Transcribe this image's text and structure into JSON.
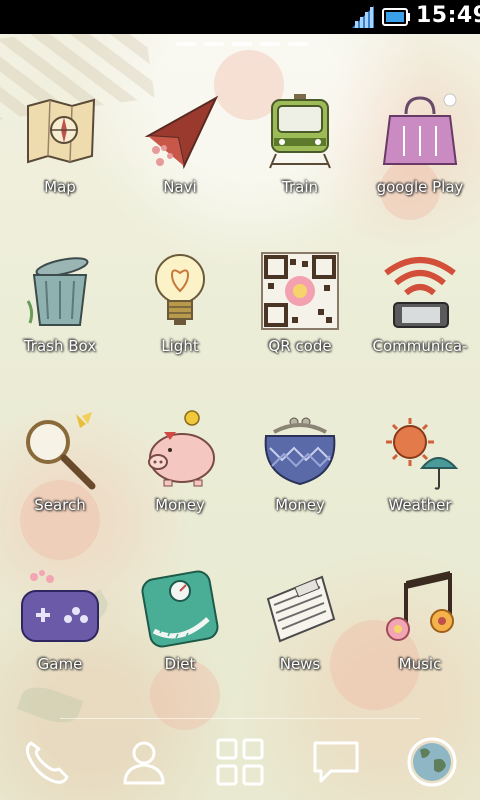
{
  "status_bar": {
    "time": "15:49",
    "signal_icon": "signal-icon",
    "battery_icon": "battery-icon"
  },
  "home": {
    "page_count": 5,
    "active_page": 3,
    "apps": [
      {
        "label": "Map",
        "icon": "map-icon"
      },
      {
        "label": "Navi",
        "icon": "navi-arrow-icon"
      },
      {
        "label": "Train",
        "icon": "train-icon"
      },
      {
        "label": "google Play",
        "icon": "shopping-bag-icon"
      },
      {
        "label": "Trash Box",
        "icon": "trash-can-icon"
      },
      {
        "label": "Light",
        "icon": "light-bulb-icon"
      },
      {
        "label": "QR code",
        "icon": "qr-code-icon"
      },
      {
        "label": "Communica-",
        "icon": "wifi-icon"
      },
      {
        "label": "Search",
        "icon": "magnifier-icon"
      },
      {
        "label": "Money",
        "icon": "piggy-bank-icon"
      },
      {
        "label": "Money",
        "icon": "purse-icon"
      },
      {
        "label": "Weather",
        "icon": "sun-umbrella-icon"
      },
      {
        "label": "Game",
        "icon": "game-console-icon"
      },
      {
        "label": "Diet",
        "icon": "scale-icon"
      },
      {
        "label": "News",
        "icon": "newspaper-icon"
      },
      {
        "label": "Music",
        "icon": "music-note-icon"
      }
    ]
  },
  "dock": {
    "items": [
      {
        "name": "phone",
        "icon": "phone-icon"
      },
      {
        "name": "contacts",
        "icon": "contacts-icon"
      },
      {
        "name": "apps",
        "icon": "app-drawer-icon"
      },
      {
        "name": "messaging",
        "icon": "message-icon"
      },
      {
        "name": "browser",
        "icon": "globe-icon"
      }
    ]
  },
  "colors": {
    "status_bar_bg": "#000000",
    "label_text": "#ffffff",
    "wallpaper": "#eceddb"
  }
}
